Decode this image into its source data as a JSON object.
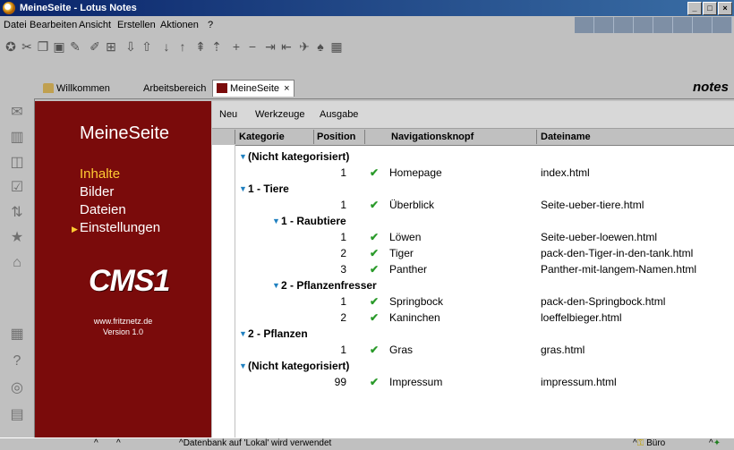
{
  "window": {
    "title": "MeineSeite - Lotus Notes",
    "min": "_",
    "max": "□",
    "close": "×"
  },
  "menu": [
    "Datei",
    "Bearbeiten",
    "Ansicht",
    "Erstellen",
    "Aktionen",
    "?"
  ],
  "tabs": {
    "home": "Willkommen",
    "workspace": "Arbeitsbereich",
    "active": "MeineSeite",
    "close": "×",
    "brand": "notes"
  },
  "nav": {
    "title": "MeineSeite",
    "items": [
      "Inhalte",
      "Bilder",
      "Dateien",
      "Einstellungen"
    ],
    "logo": "CMS1",
    "url": "www.fritznetz.de",
    "version": "Version 1.0"
  },
  "actions": [
    "Neu",
    "Werkzeuge",
    "Ausgabe"
  ],
  "columns": [
    "Kategorie",
    "Position",
    "Navigationsknopf",
    "Dateiname"
  ],
  "rows": [
    {
      "type": "cat",
      "level": 0,
      "label": "(Nicht kategorisiert)"
    },
    {
      "type": "doc",
      "pos": "1",
      "nav": "Homepage",
      "file": "index.html"
    },
    {
      "type": "cat",
      "level": 0,
      "label": "1 - Tiere"
    },
    {
      "type": "doc",
      "pos": "1",
      "nav": "Überblick",
      "file": "Seite-ueber-tiere.html"
    },
    {
      "type": "cat",
      "level": 1,
      "label": "1 - Raubtiere"
    },
    {
      "type": "doc",
      "pos": "1",
      "nav": "Löwen",
      "file": "Seite-ueber-loewen.html"
    },
    {
      "type": "doc",
      "pos": "2",
      "nav": "Tiger",
      "file": "pack-den-Tiger-in-den-tank.html"
    },
    {
      "type": "doc",
      "pos": "3",
      "nav": "Panther",
      "file": "Panther-mit-langem-Namen.html"
    },
    {
      "type": "cat",
      "level": 1,
      "label": "2 - Pflanzenfresser"
    },
    {
      "type": "doc",
      "pos": "1",
      "nav": "Springbock",
      "file": "pack-den-Springbock.html"
    },
    {
      "type": "doc",
      "pos": "2",
      "nav": "Kaninchen",
      "file": "loeffelbieger.html"
    },
    {
      "type": "cat",
      "level": 0,
      "label": "2 - Pflanzen"
    },
    {
      "type": "doc",
      "pos": "1",
      "nav": "Gras",
      "file": "gras.html"
    },
    {
      "type": "cat",
      "level": 0,
      "label": "(Nicht kategorisiert)"
    },
    {
      "type": "doc",
      "pos": "99",
      "nav": "Impressum",
      "file": "impressum.html"
    }
  ],
  "status": {
    "message": "Datenbank auf 'Lokal' wird verwendet",
    "location": "Büro"
  },
  "colors": {
    "navBg": "#7a0b0b",
    "navActive": "#ffcc33",
    "check": "#2a9a2a",
    "titleBar": "#0a246a"
  }
}
